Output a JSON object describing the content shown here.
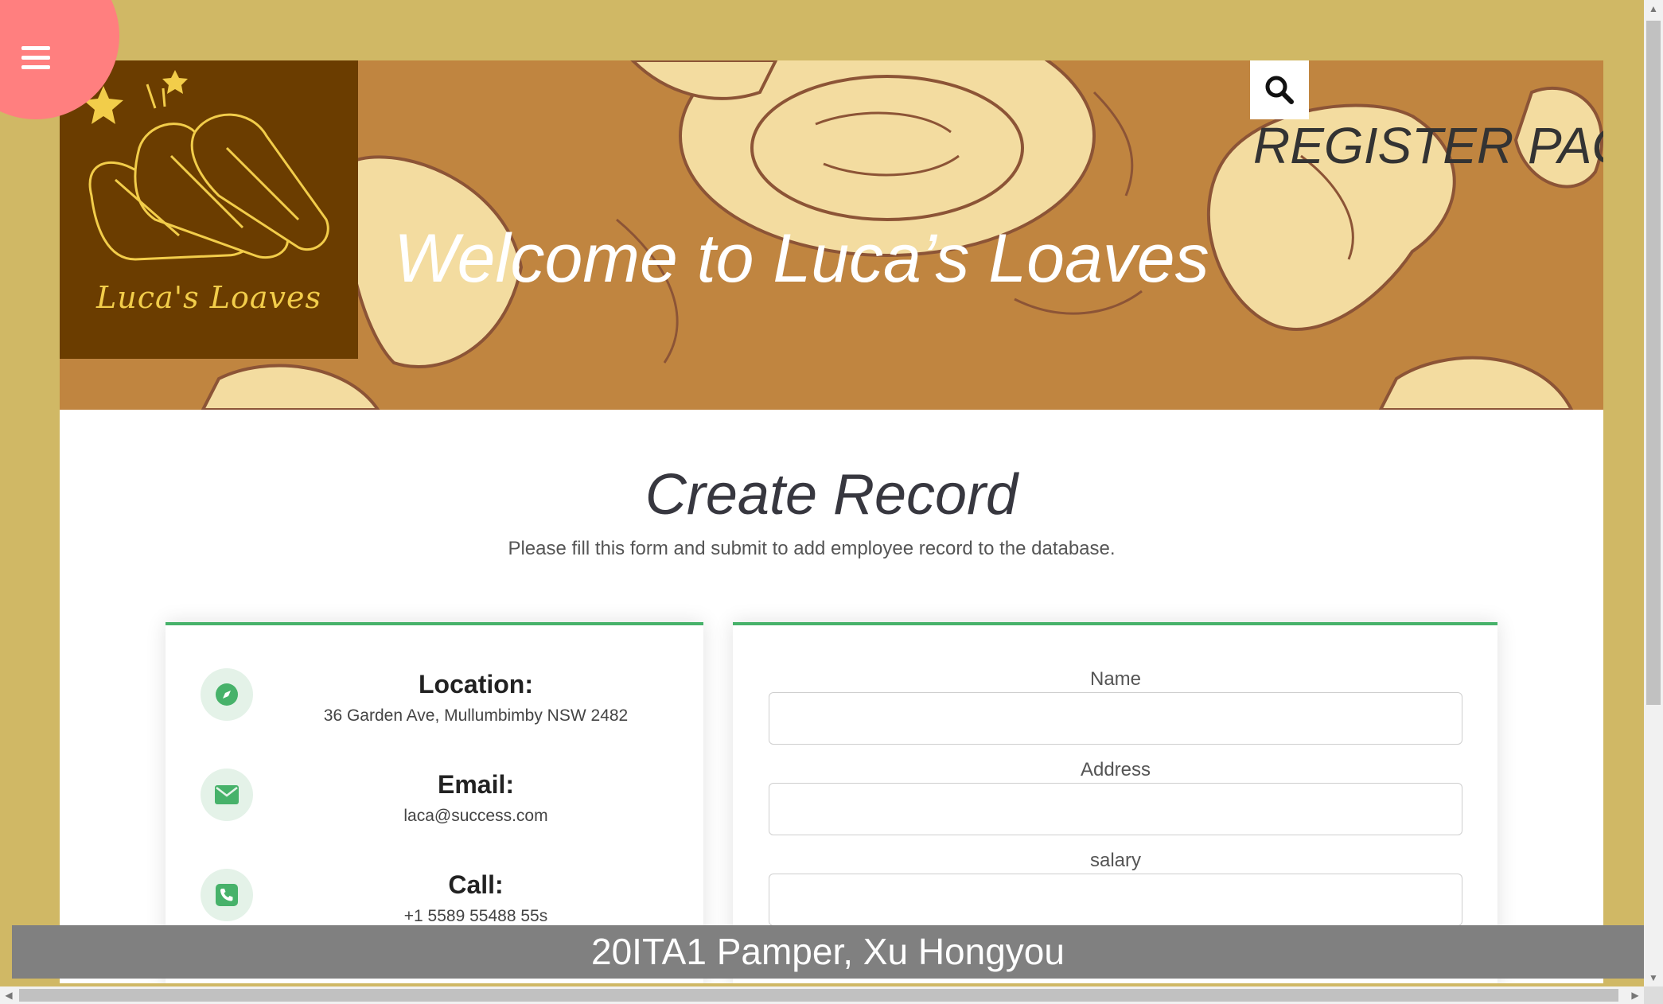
{
  "header": {
    "page_label": "REGISTER PAGE",
    "welcome": "Welcome to Luca’s Loaves",
    "logo_text": "Luca's Loaves"
  },
  "menu": {
    "icon": "hamburger-icon"
  },
  "search": {
    "icon": "search-icon"
  },
  "section": {
    "title": "Create Record",
    "subtitle": "Please fill this form and submit to add employee record to the database."
  },
  "contact": [
    {
      "icon": "compass-icon",
      "title": "Location:",
      "text": "36 Garden Ave, Mullumbimby NSW 2482"
    },
    {
      "icon": "envelope-icon",
      "title": "Email:",
      "text": "laca@success.com"
    },
    {
      "icon": "phone-icon",
      "title": "Call:",
      "text": "+1 5589 55488 55s"
    }
  ],
  "form": {
    "fields": [
      {
        "label": "Name",
        "value": ""
      },
      {
        "label": "Address",
        "value": ""
      },
      {
        "label": "salary",
        "value": ""
      }
    ]
  },
  "footer": {
    "text": "20ITA1 Pamper, Xu Hongyou"
  },
  "colors": {
    "page_bg": "#d0b865",
    "hero_bg": "#c08540",
    "logo_bg": "#6b3d00",
    "accent_green": "#47b26a",
    "menu_button": "#ff7f7f",
    "footer_bar": "#808080"
  }
}
